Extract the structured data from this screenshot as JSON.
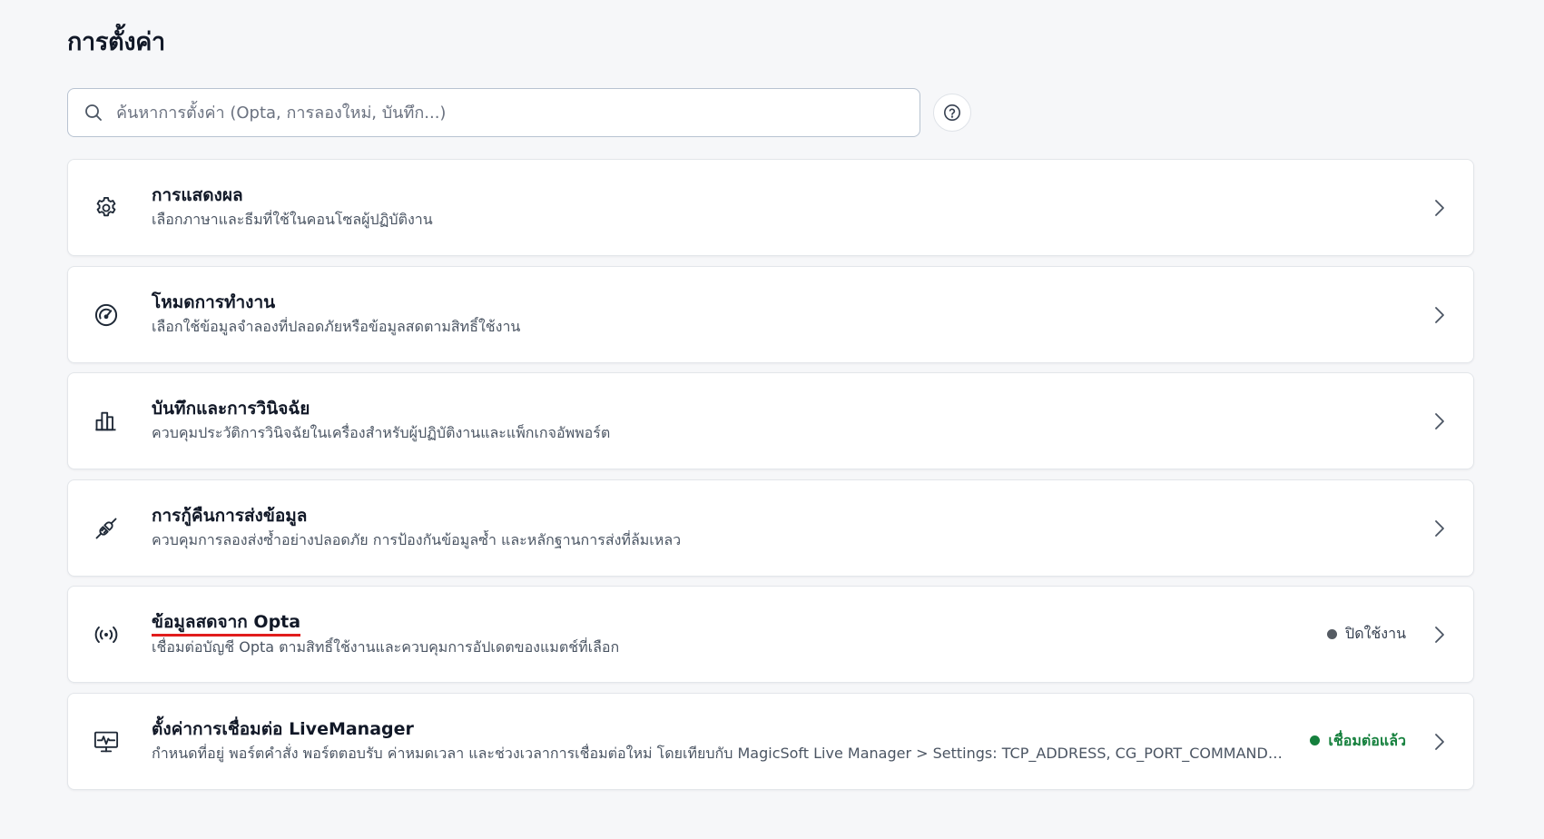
{
  "page": {
    "title": "การตั้งค่า"
  },
  "search": {
    "placeholder": "ค้นหาการตั้งค่า (Opta, การลองใหม่, บันทึก...)",
    "value": "",
    "icon": "search-icon",
    "help_icon": "help-circle-icon"
  },
  "colors": {
    "status_off": "#555b63",
    "status_connected": "#15803d",
    "highlight_underline": "#e11d1d"
  },
  "settings": [
    {
      "icon": "gear-icon",
      "title": "การแสดงผล",
      "description": "เลือกภาษาและธีมที่ใช้ในคอนโซลผู้ปฏิบัติงาน"
    },
    {
      "icon": "gauge-icon",
      "title": "โหมดการทำงาน",
      "description": "เลือกใช้ข้อมูลจำลองที่ปลอดภัยหรือข้อมูลสดตามสิทธิ์ใช้งาน"
    },
    {
      "icon": "bar-chart-icon",
      "title": "บันทึกและการวินิจฉัย",
      "description": "ควบคุมประวัติการวินิจฉัยในเครื่องสำหรับผู้ปฏิบัติงานและแพ็กเกจอัพพอร์ต"
    },
    {
      "icon": "plug-icon",
      "title": "การกู้คืนการส่งข้อมูล",
      "description": "ควบคุมการลองส่งซ้ำอย่างปลอดภัย การป้องกันข้อมูลซ้ำ และหลักฐานการส่งที่ล้มเหลว"
    },
    {
      "icon": "broadcast-icon",
      "title": "ข้อมูลสดจาก Opta",
      "description": "เชื่อมต่อบัญชี Opta ตามสิทธิ์ใช้งานและควบคุมการอัปเดตของแมตช์ที่เลือก",
      "status": "ปิดใช้งาน"
    },
    {
      "icon": "monitor-pulse-icon",
      "title": "ตั้งค่าการเชื่อมต่อ LiveManager",
      "description": "กำหนดที่อยู่ พอร์ตคำสั่ง พอร์ตตอบรับ ค่าหมดเวลา และช่วงเวลาการเชื่อมต่อใหม่ โดยเทียบกับ MagicSoft Live Manager > Settings: TCP_ADDRESS, CG_PORT_COMMAND และ CG_PORT_REPLY",
      "status": "เชื่อมต่อแล้ว"
    }
  ]
}
